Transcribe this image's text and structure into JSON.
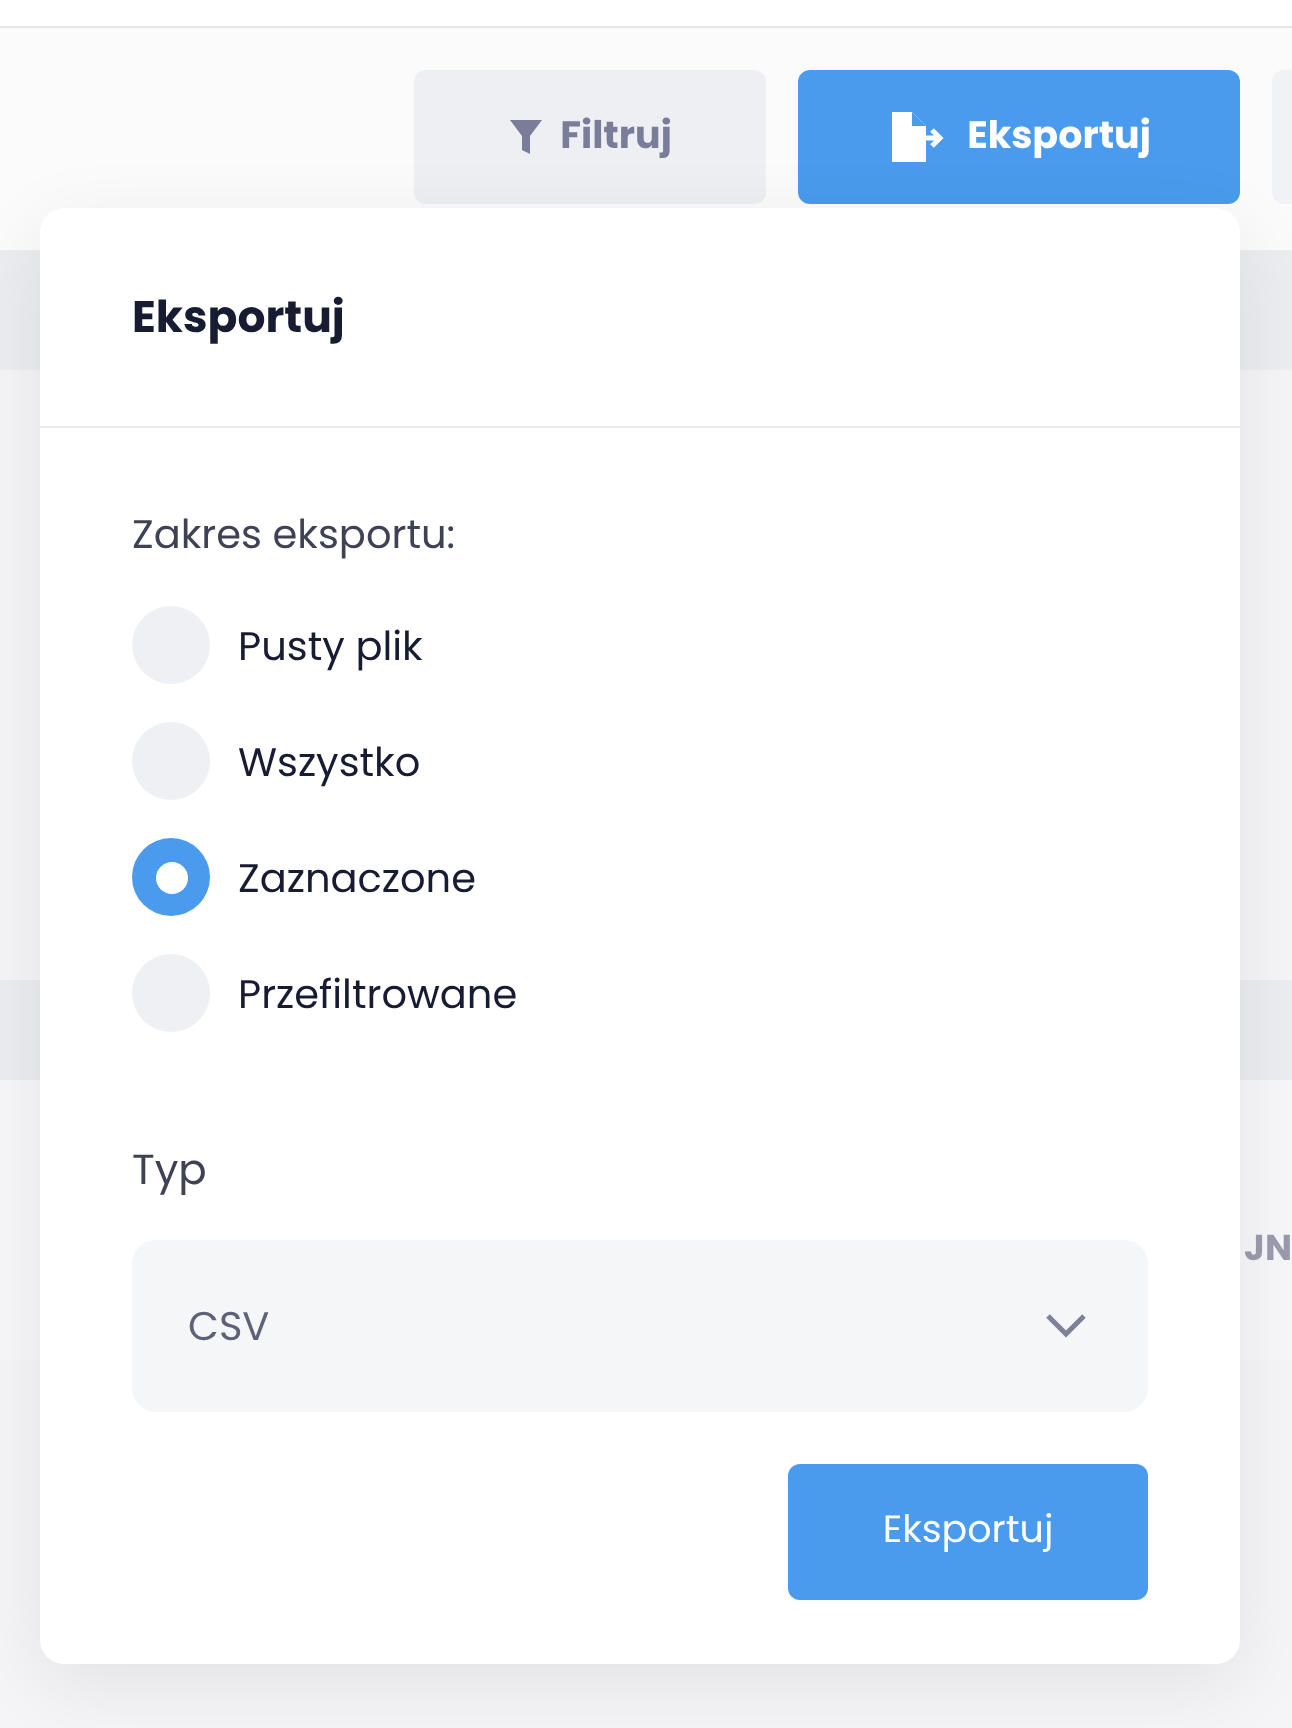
{
  "toolbar": {
    "buttons": [
      {
        "label": "Filtruj",
        "kind": "secondary"
      },
      {
        "label": "Eksportuj",
        "kind": "primary"
      }
    ]
  },
  "background": {
    "column_header_fragment": "JN"
  },
  "export_popover": {
    "title": "Eksportuj",
    "scope_label": "Zakres eksportu:",
    "scope_options": [
      {
        "label": "Pusty plik",
        "selected": false
      },
      {
        "label": "Wszystko",
        "selected": false
      },
      {
        "label": "Zaznaczone",
        "selected": true
      },
      {
        "label": "Przefiltrowane",
        "selected": false
      }
    ],
    "type_label": "Typ",
    "type_value": "CSV",
    "submit": "Eksportuj"
  }
}
